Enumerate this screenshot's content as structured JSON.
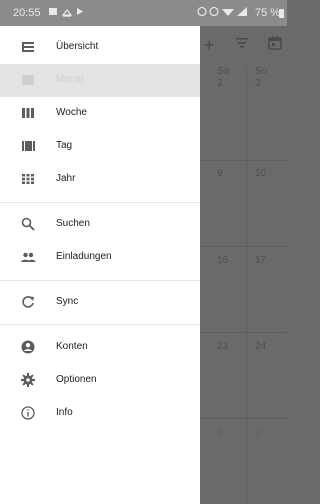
{
  "status_bar": {
    "time": "20:55",
    "battery": "75 %"
  },
  "calendar_bg": {
    "day_headers": [
      "Sa",
      "So"
    ],
    "rows": [
      [
        "2",
        "3"
      ],
      [
        "9",
        "10"
      ],
      [
        "16",
        "17"
      ],
      [
        "23",
        "24"
      ],
      [
        "2",
        "3"
      ]
    ]
  },
  "drawer": {
    "items": [
      {
        "label": "Übersicht",
        "icon": "list-view-icon"
      },
      {
        "label": "Monat",
        "icon": "month-view-icon",
        "selected": true
      },
      {
        "label": "Woche",
        "icon": "week-view-icon"
      },
      {
        "label": "Tag",
        "icon": "day-view-icon"
      },
      {
        "label": "Jahr",
        "icon": "year-view-icon"
      },
      {
        "label": "Suchen",
        "icon": "search-icon"
      },
      {
        "label": "Einladungen",
        "icon": "people-icon"
      },
      {
        "label": "Sync",
        "icon": "sync-icon"
      },
      {
        "label": "Konten",
        "icon": "account-icon"
      },
      {
        "label": "Optionen",
        "icon": "gear-icon"
      },
      {
        "label": "Info",
        "icon": "info-icon"
      }
    ]
  }
}
